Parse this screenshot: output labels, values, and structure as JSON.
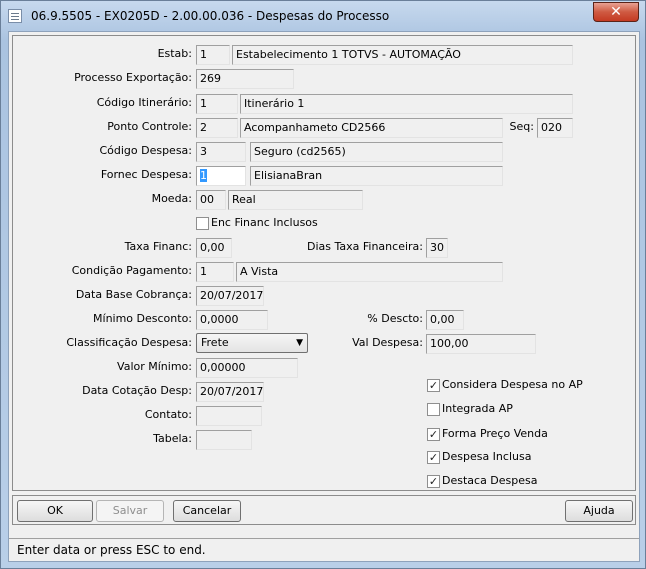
{
  "window": {
    "title": "06.9.5505 - EX0205D - 2.00.00.036 - Despesas do Processo",
    "close_glyph": "✕"
  },
  "form": {
    "estab": {
      "label": "Estab:",
      "code": "1",
      "name": "Estabelecimento 1 TOTVS - AUTOMAÇÃO"
    },
    "processo": {
      "label": "Processo Exportação:",
      "value": "269"
    },
    "itinerario": {
      "label": "Código Itinerário:",
      "code": "1",
      "name": "Itinerário 1"
    },
    "ponto": {
      "label": "Ponto Controle:",
      "code": "2",
      "name": "Acompanhameto  CD2566",
      "seq_label": "Seq:",
      "seq": "020"
    },
    "despesa": {
      "label": "Código Despesa:",
      "code": "3",
      "name": "Seguro (cd2565)"
    },
    "fornec": {
      "label": "Fornec Despesa:",
      "code": "1",
      "name": "ElisianaBran"
    },
    "moeda": {
      "label": "Moeda:",
      "code": "00",
      "name": "Real"
    },
    "enc_financ": {
      "label": "Enc Financ Inclusos",
      "checked": false
    },
    "taxa_financ": {
      "label": "Taxa Financ:",
      "value": "0,00"
    },
    "dias_taxa": {
      "label": "Dias Taxa Financeira:",
      "value": "30"
    },
    "condicao": {
      "label": "Condição Pagamento:",
      "code": "1",
      "name": "A Vista"
    },
    "data_base": {
      "label": "Data Base Cobrança:",
      "value": "20/07/2017"
    },
    "minimo_desconto": {
      "label": "Mínimo Desconto:",
      "value": "0,0000"
    },
    "pct_descto": {
      "label": "% Descto:",
      "value": "0,00"
    },
    "classificacao": {
      "label": "Classificação Despesa:",
      "value": "Frete"
    },
    "val_despesa": {
      "label": "Val Despesa:",
      "value": "100,00"
    },
    "valor_minimo": {
      "label": "Valor Mínimo:",
      "value": "0,00000"
    },
    "data_cotacao": {
      "label": "Data Cotação Desp:",
      "value": "20/07/2017"
    },
    "contato": {
      "label": "Contato:",
      "value": ""
    },
    "tabela": {
      "label": "Tabela:",
      "value": ""
    }
  },
  "checkboxes": [
    {
      "label": "Considera Despesa no AP",
      "checked": true
    },
    {
      "label": "Integrada AP",
      "checked": false
    },
    {
      "label": "Forma Preço Venda",
      "checked": true
    },
    {
      "label": "Despesa Inclusa",
      "checked": true
    },
    {
      "label": "Destaca Despesa",
      "checked": true
    }
  ],
  "check_glyph": "✓",
  "buttons": {
    "ok": "OK",
    "salvar": "Salvar",
    "cancelar": "Cancelar",
    "ajuda": "Ajuda"
  },
  "status": "Enter data or press ESC to end."
}
